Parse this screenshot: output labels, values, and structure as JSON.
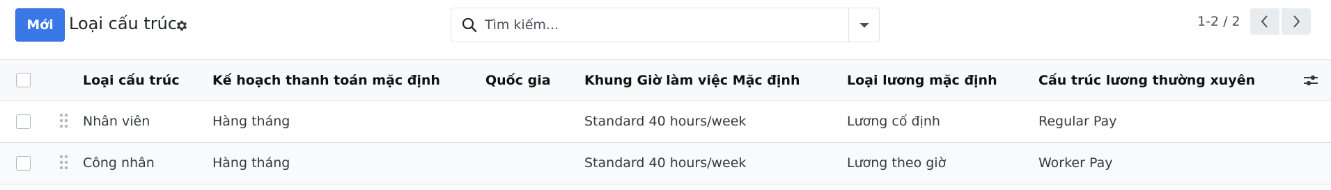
{
  "control_panel": {
    "new_button": "Mới",
    "title": "Loại cấu trúc",
    "search": {
      "placeholder": "Tìm kiếm...",
      "value": ""
    },
    "pager": "1-2 / 2"
  },
  "table": {
    "columns": [
      "Loại cấu trúc",
      "Kế hoạch thanh toán mặc định",
      "Quốc gia",
      "Khung Giờ làm việc Mặc định",
      "Loại lương mặc định",
      "Cấu trúc lương thường xuyên"
    ],
    "rows": [
      [
        "Nhân viên",
        "Hàng tháng",
        "",
        "Standard 40 hours/week",
        "Lương cố định",
        "Regular Pay"
      ],
      [
        "Công nhân",
        "Hàng tháng",
        "",
        "Standard 40 hours/week",
        "Lương theo giờ",
        "Worker Pay"
      ]
    ]
  },
  "icons": {
    "gear": "gear-icon",
    "search": "search-icon",
    "dropdown": "caret-down-icon",
    "prev": "chevron-left-icon",
    "next": "chevron-right-icon",
    "drag": "drag-handle-icon",
    "optional_columns": "sliders-icon"
  },
  "colors": {
    "primary": "#3b78e7",
    "border": "#dee2e6",
    "header_bg": "#f8f9fa"
  }
}
